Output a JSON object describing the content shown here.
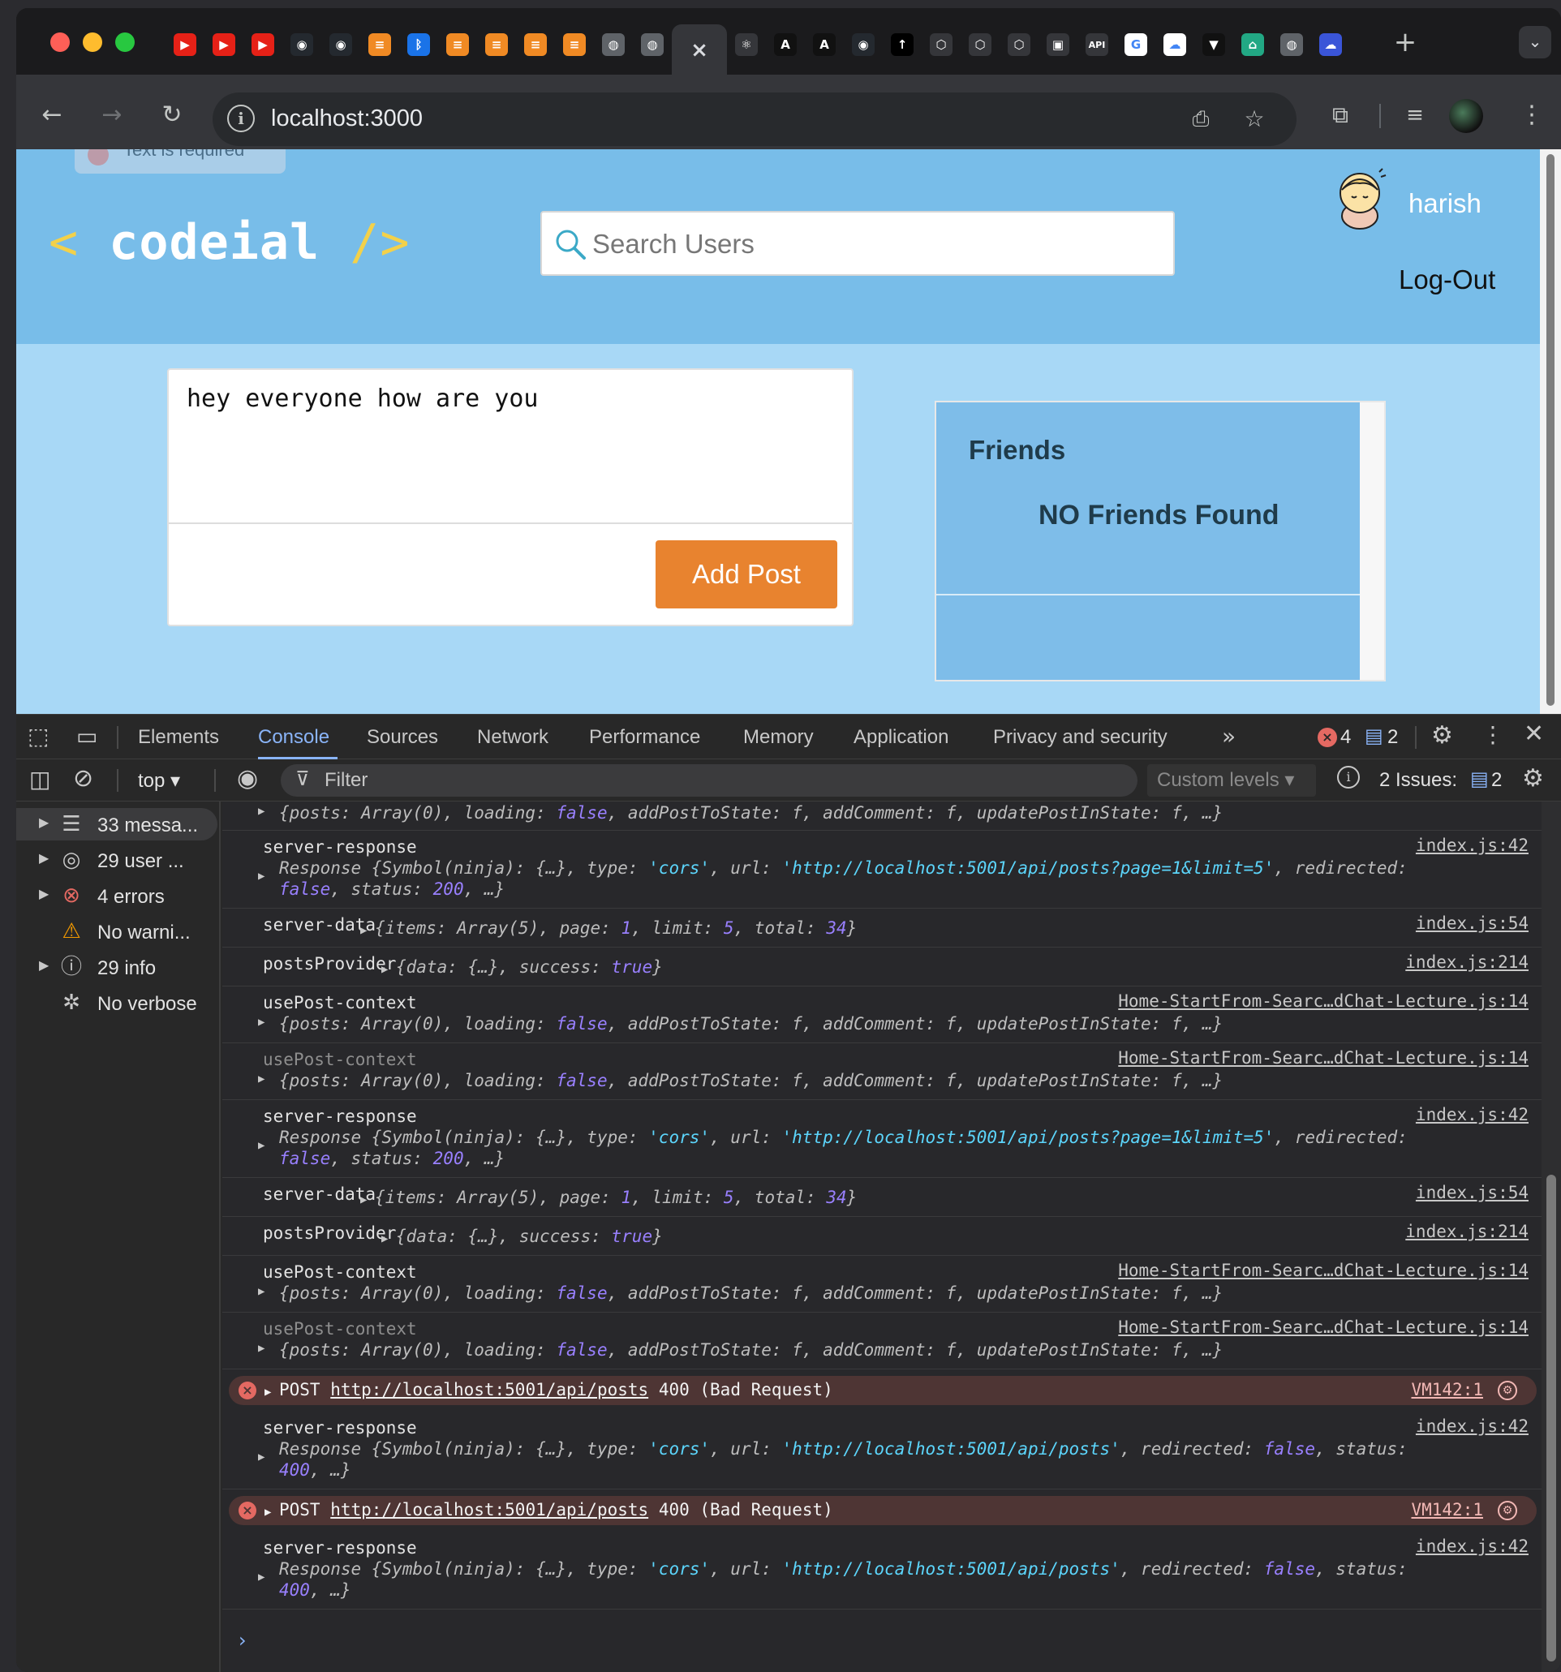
{
  "browser": {
    "tabs": [
      {
        "icon": "youtube-icon",
        "glyph": "▶",
        "color": "#e62117"
      },
      {
        "icon": "youtube-icon",
        "glyph": "▶",
        "color": "#e62117"
      },
      {
        "icon": "youtube-icon",
        "glyph": "▶",
        "color": "#e62117"
      },
      {
        "icon": "github-icon",
        "glyph": "◉",
        "color": "#24292f"
      },
      {
        "icon": "github-icon",
        "glyph": "◉",
        "color": "#24292f"
      },
      {
        "icon": "coding-ninjas-icon",
        "glyph": "≡",
        "color": "#f08a24"
      },
      {
        "icon": "bluetooth-icon",
        "glyph": "ᛒ",
        "color": "#1a73e8"
      },
      {
        "icon": "coding-ninjas-icon",
        "glyph": "≡",
        "color": "#f08a24"
      },
      {
        "icon": "coding-ninjas-icon",
        "glyph": "≡",
        "color": "#f08a24"
      },
      {
        "icon": "coding-ninjas-icon",
        "glyph": "≡",
        "color": "#f08a24"
      },
      {
        "icon": "coding-ninjas-icon",
        "glyph": "≡",
        "color": "#f08a24"
      },
      {
        "icon": "globe-icon",
        "glyph": "◍",
        "color": "#5f6368"
      },
      {
        "icon": "globe-icon",
        "glyph": "◍",
        "color": "#5f6368"
      }
    ],
    "active_tab_close": "×",
    "tabs_right": [
      {
        "icon": "react-icon",
        "glyph": "⚛",
        "color": "#35363a"
      },
      {
        "icon": "anthropic-icon",
        "glyph": "A",
        "color": "#111111"
      },
      {
        "icon": "anthropic-icon",
        "glyph": "A",
        "color": "#111111"
      },
      {
        "icon": "github-icon",
        "glyph": "◉",
        "color": "#24292f"
      },
      {
        "icon": "app-icon",
        "glyph": "↑",
        "color": "#000000"
      },
      {
        "icon": "openai-icon",
        "glyph": "⬡",
        "color": "#35363a"
      },
      {
        "icon": "openai-icon",
        "glyph": "⬡",
        "color": "#35363a"
      },
      {
        "icon": "openai-icon",
        "glyph": "⬡",
        "color": "#35363a"
      },
      {
        "icon": "chip-icon",
        "glyph": "▣",
        "color": "#35363a"
      },
      {
        "icon": "api-icon",
        "glyph": "API",
        "color": "#35363a"
      },
      {
        "icon": "google-icon",
        "glyph": "G",
        "color": "#ffffff"
      },
      {
        "icon": "google-cloud-icon",
        "glyph": "☁",
        "color": "#ffffff"
      },
      {
        "icon": "vercel-icon",
        "glyph": "▼",
        "color": "#111111"
      },
      {
        "icon": "home-icon",
        "glyph": "⌂",
        "color": "#22a884"
      },
      {
        "icon": "globe-icon",
        "glyph": "◍",
        "color": "#5f6368"
      },
      {
        "icon": "cloud-dashboard-icon",
        "glyph": "☁",
        "color": "#3a55d8"
      }
    ],
    "url": "localhost:3000"
  },
  "app": {
    "toast_text": "Text is required",
    "logo_open": "<",
    "logo_name": "codeial",
    "logo_close": "/>",
    "search_placeholder": "Search Users",
    "username": "harish",
    "logout_label": "Log-Out",
    "post_text": "hey everyone how are you",
    "add_post_label": "Add Post",
    "friends_title": "Friends",
    "no_friends": "NO Friends Found"
  },
  "devtools": {
    "tabs": [
      "Elements",
      "Console",
      "Sources",
      "Network",
      "Performance",
      "Memory",
      "Application",
      "Privacy and security"
    ],
    "active_tab": "Console",
    "error_count": "4",
    "issue_count": "2",
    "context": "top",
    "filter_placeholder": "Filter",
    "levels": "Custom levels",
    "issues_label": "2 Issues:",
    "issues_badge": "2",
    "sidebar": [
      {
        "label": "33 messa...",
        "icon": "list-icon"
      },
      {
        "label": "29 user ...",
        "icon": "user-icon"
      },
      {
        "label": "4 errors",
        "icon": "error-icon"
      },
      {
        "label": "No warni...",
        "icon": "warning-icon"
      },
      {
        "label": "29 info",
        "icon": "info-icon"
      },
      {
        "label": "No verbose",
        "icon": "bug-icon"
      }
    ],
    "logs": [
      {
        "label": "",
        "src": "",
        "lines": [
          "{posts: Array(0), loading: false, addPostToState: f, addComment: f, updatePostInState: f, …}"
        ]
      },
      {
        "label": "server-response",
        "src": "index.js:42",
        "lines": [
          "Response {Symbol(ninja): {…}, type: 'cors', url: 'http://localhost:5001/api/posts?page=1&limit=5', redirected:",
          "false, status: 200, …}"
        ]
      },
      {
        "label": "server-data",
        "src": "index.js:54",
        "inline": "{items: Array(5), page: 1, limit: 5, total: 34}"
      },
      {
        "label": "postsProvider",
        "src": "index.js:214",
        "inline": "{data: {…}, success: true}"
      },
      {
        "label": "usePost-context",
        "src": "Home-StartFrom-Searc…dChat-Lecture.js:14",
        "lines": [
          "{posts: Array(0), loading: false, addPostToState: f, addComment: f, updatePostInState: f, …}"
        ]
      },
      {
        "label": "usePost-context",
        "src": "Home-StartFrom-Searc…dChat-Lecture.js:14",
        "lines": [
          "{posts: Array(0), loading: false, addPostToState: f, addComment: f, updatePostInState: f, …}"
        ],
        "dim": true
      },
      {
        "label": "server-response",
        "src": "index.js:42",
        "lines": [
          "Response {Symbol(ninja): {…}, type: 'cors', url: 'http://localhost:5001/api/posts?page=1&limit=5', redirected:",
          "false, status: 200, …}"
        ]
      },
      {
        "label": "server-data",
        "src": "index.js:54",
        "inline": "{items: Array(5), page: 1, limit: 5, total: 34}"
      },
      {
        "label": "postsProvider",
        "src": "index.js:214",
        "inline": "{data: {…}, success: true}"
      },
      {
        "label": "usePost-context",
        "src": "Home-StartFrom-Searc…dChat-Lecture.js:14",
        "lines": [
          "{posts: Array(0), loading: false, addPostToState: f, addComment: f, updatePostInState: f, …}"
        ]
      },
      {
        "label": "usePost-context",
        "src": "Home-StartFrom-Searc…dChat-Lecture.js:14",
        "lines": [
          "{posts: Array(0), loading: false, addPostToState: f, addComment: f, updatePostInState: f, …}"
        ],
        "dim": true
      },
      {
        "error": true,
        "method": "POST",
        "url": "http://localhost:5001/api/posts",
        "status": "400 (Bad Request)",
        "src": "VM142:1"
      },
      {
        "label": "server-response",
        "src": "index.js:42",
        "lines": [
          "Response {Symbol(ninja): {…}, type: 'cors', url: 'http://localhost:5001/api/posts', redirected: false, status:",
          "400, …}"
        ]
      },
      {
        "error": true,
        "method": "POST",
        "url": "http://localhost:5001/api/posts",
        "status": "400 (Bad Request)",
        "src": "VM142:1"
      },
      {
        "label": "server-response",
        "src": "index.js:42",
        "lines": [
          "Response {Symbol(ninja): {…}, type: 'cors', url: 'http://localhost:5001/api/posts', redirected: false, status:",
          "400, …}"
        ]
      }
    ],
    "prompt": "›"
  },
  "colors": {
    "navbar": "#78bde9",
    "page_bg": "#a8d8f6",
    "accent": "#e8832f",
    "devtools_accent": "#8ab4f8"
  }
}
